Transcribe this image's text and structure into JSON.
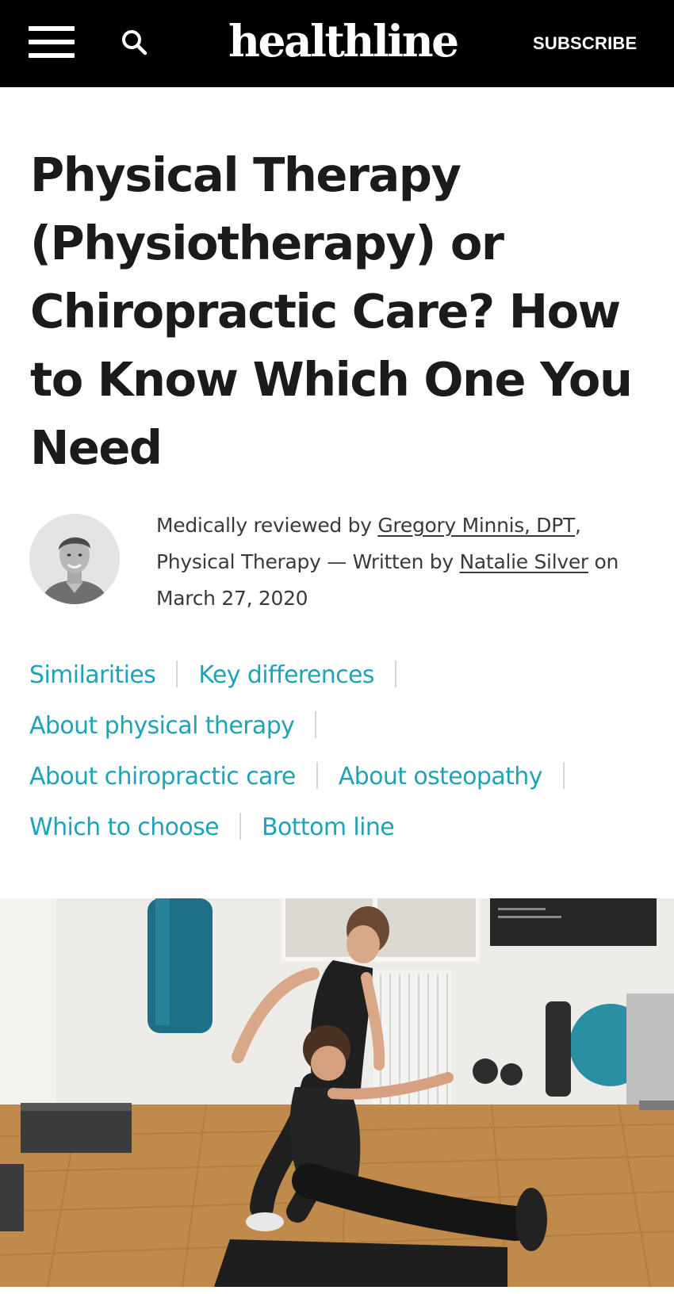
{
  "header": {
    "logo_text": "healthline",
    "subscribe_label": "SUBSCRIBE",
    "menu_icon": "hamburger-menu-icon",
    "search_icon": "search-icon",
    "background_color": "#000000"
  },
  "article": {
    "title": "Physical Therapy (Physiotherapy) or Chiropractic Care? How to Know Which One You Need",
    "byline": {
      "reviewed_prefix": "Medically reviewed by ",
      "reviewer": "Gregory Minnis, DPT",
      "reviewer_credential": ", Physical Therapy — Written by ",
      "author": "Natalie Silver",
      "date_text": " on March 27, 2020"
    }
  },
  "jump_links": {
    "similarities": "Similarities",
    "key_differences": "Key differences",
    "about_physical_therapy": "About physical therapy",
    "about_chiropractic_care": "About chiropractic care",
    "about_osteopathy": "About osteopathy",
    "which_to_choose": "Which to choose",
    "bottom_line": "Bottom line",
    "link_color": "#1fa3b7"
  }
}
